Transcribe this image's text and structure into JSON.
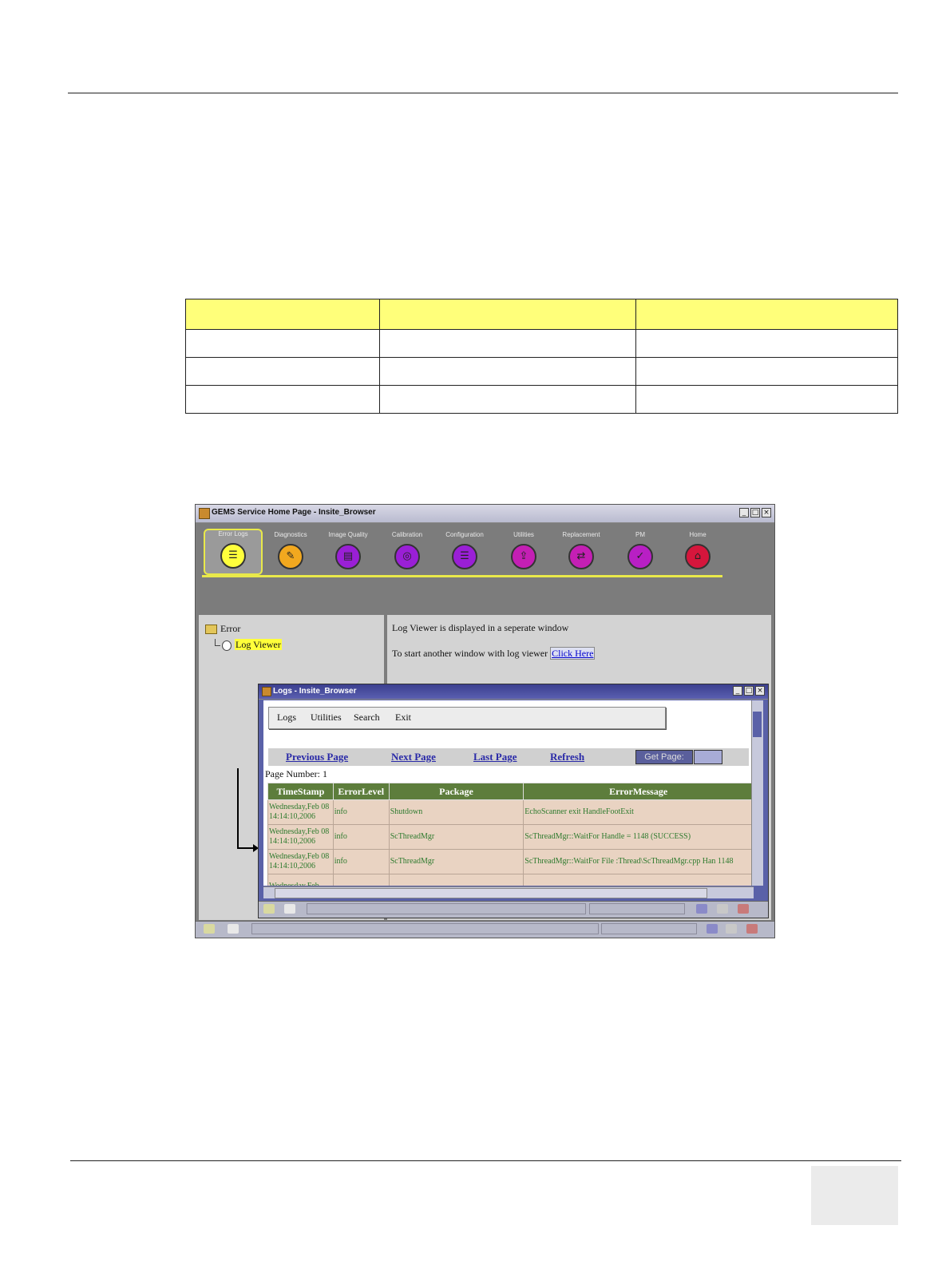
{
  "document": {
    "table": {
      "rows": 4,
      "cols": 3
    }
  },
  "screenshot": {
    "window_title": "GEMS Service Home Page - Insite_Browser",
    "window_buttons": [
      "_",
      "□",
      "×"
    ],
    "toolbar": [
      {
        "label": "Error Logs",
        "color": "#ffff3c",
        "glyph": "☰",
        "active": true
      },
      {
        "label": "Diagnostics",
        "color": "#f2a81f",
        "glyph": "✎",
        "active": false
      },
      {
        "label": "Image Quality",
        "color": "#9a1fd6",
        "glyph": "▤",
        "active": false
      },
      {
        "label": "Calibration",
        "color": "#9a1fd6",
        "glyph": "◎",
        "active": false
      },
      {
        "label": "Configuration",
        "color": "#9a1fd6",
        "glyph": "☰",
        "active": false
      },
      {
        "label": "Utilities",
        "color": "#c41fb4",
        "glyph": "⇪",
        "active": false
      },
      {
        "label": "Replacement",
        "color": "#c41fb4",
        "glyph": "⇄",
        "active": false
      },
      {
        "label": "PM",
        "color": "#b81fc4",
        "glyph": "✓",
        "active": false
      },
      {
        "label": "Home",
        "color": "#d6163c",
        "glyph": "⌂",
        "active": false
      }
    ],
    "tree": {
      "root": "Error",
      "child": "Log Viewer"
    },
    "message": {
      "line1": "Log Viewer is displayed in a seperate window",
      "line2": "To start another window with log viewer",
      "link": "Click Here"
    },
    "logs_window": {
      "title": "Logs - Insite_Browser",
      "menu": [
        "Logs",
        "Utilities",
        "Search",
        "Exit"
      ],
      "nav": [
        "Previous Page",
        "Next Page",
        "Last Page",
        "Refresh"
      ],
      "get_page": "Get Page:",
      "page_number": "Page Number: 1",
      "columns": [
        "TimeStamp",
        "ErrorLevel",
        "Package",
        "ErrorMessage"
      ],
      "rows": [
        [
          "Wednesday,Feb 08 14:14:10,2006",
          "info",
          "Shutdown",
          "EchoScanner exit HandleFootExit"
        ],
        [
          "Wednesday,Feb 08 14:14:10,2006",
          "info",
          "ScThreadMgr",
          "ScThreadMgr::WaitFor Handle = 1148 (SUCCESS)"
        ],
        [
          "Wednesday,Feb 08 14:14:10,2006",
          "info",
          "ScThreadMgr",
          "ScThreadMgr::WaitFor File :Thread\\ScThreadMgr.cpp Han 1148"
        ],
        [
          "Wednesday,Feb",
          "",
          "",
          ""
        ]
      ]
    }
  }
}
